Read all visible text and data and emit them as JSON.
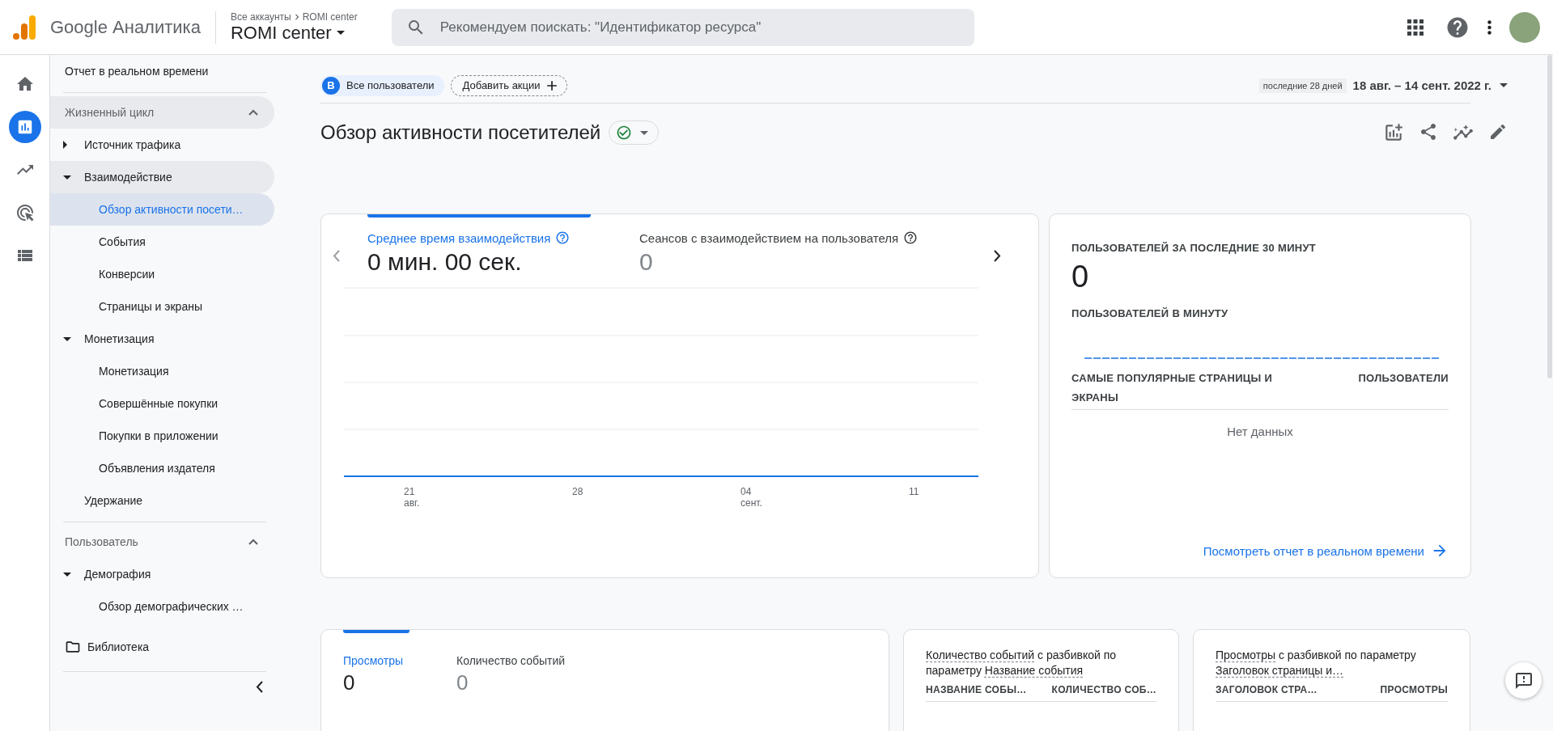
{
  "header": {
    "product": "Google Аналитика",
    "breadcrumb": [
      "Все аккаунты",
      "ROMI center"
    ],
    "property": "ROMI center",
    "search": {
      "placeholder": "Рекомендуем поискать: \"Идентификатор ресурса\""
    }
  },
  "rail": [
    {
      "kind": "home",
      "selected": false
    },
    {
      "kind": "reports",
      "selected": true
    },
    {
      "kind": "explore",
      "selected": false
    },
    {
      "kind": "advertising",
      "selected": false
    },
    {
      "kind": "configure",
      "selected": false
    }
  ],
  "sidebar": {
    "top_item": "Отчет в реальном времени",
    "sections": [
      {
        "title": "Жизненный цикл",
        "expanded": true,
        "highlighted": true,
        "items": [
          {
            "label": "Источник трафика",
            "kind": "group",
            "expanded": false,
            "highlighted": false,
            "selected": false
          },
          {
            "label": "Взаимодействие",
            "kind": "group",
            "expanded": true,
            "highlighted": true,
            "selected": false,
            "children": [
              {
                "label": "Обзор активности посети…",
                "selected": true
              },
              {
                "label": "События",
                "selected": false
              },
              {
                "label": "Конверсии",
                "selected": false
              },
              {
                "label": "Страницы и экраны",
                "selected": false
              }
            ]
          },
          {
            "label": "Монетизация",
            "kind": "group",
            "expanded": true,
            "highlighted": false,
            "selected": false,
            "children": [
              {
                "label": "Монетизация",
                "selected": false
              },
              {
                "label": "Совершённые покупки",
                "selected": false
              },
              {
                "label": "Покупки в приложении",
                "selected": false
              },
              {
                "label": "Объявления издателя",
                "selected": false
              }
            ]
          },
          {
            "label": "Удержание",
            "kind": "link",
            "highlighted": false,
            "selected": false
          }
        ]
      },
      {
        "title": "Пользователь",
        "expanded": true,
        "highlighted": false,
        "items": [
          {
            "label": "Демография",
            "kind": "group",
            "expanded": true,
            "highlighted": false,
            "selected": false,
            "children": [
              {
                "label": "Обзор демографических …",
                "selected": false
              }
            ]
          }
        ]
      }
    ],
    "library": "Библиотека"
  },
  "toolbar": {
    "segment": {
      "letter": "В",
      "label": "Все пользователи"
    },
    "compare": "Добавить акции",
    "date_badge": "последние 28 дней",
    "date_range": "18 авг. – 14 сент. 2022 г."
  },
  "report": {
    "title": "Обзор активности посетителей"
  },
  "engagement_card": {
    "metrics": [
      {
        "label": "Среднее время взаимодействия",
        "value": "0 мин. 00 сек.",
        "selected": true
      },
      {
        "label": "Сеансов с взаимодействием на пользователя",
        "value": "0",
        "selected": false
      }
    ],
    "axis_labels": [
      {
        "day": "21",
        "month": "авг."
      },
      {
        "day": "28"
      },
      {
        "day": "04",
        "month": "сент."
      },
      {
        "day": "11"
      }
    ]
  },
  "realtime_card": {
    "title": "ПОЛЬЗОВАТЕЛЕЙ ЗА ПОСЛЕДНИЕ 30 МИНУТ",
    "value": "0",
    "subtitle": "ПОЛЬЗОВАТЕЛЕЙ В МИНУТУ",
    "columns": [
      "САМЫЕ ПОПУЛЯРНЫЕ СТРАНИЦЫ И ЭКРАНЫ",
      "ПОЛЬЗОВАТЕЛИ"
    ],
    "empty": "Нет данных",
    "link": "Посмотреть отчет в реальном времени"
  },
  "views_card": {
    "metrics": [
      {
        "label": "Просмотры",
        "value": "0",
        "selected": true
      },
      {
        "label": "Количество событий",
        "value": "0",
        "selected": false
      }
    ]
  },
  "breakdown_cards": [
    {
      "title": [
        {
          "text": "Количество событий",
          "underlined": true
        },
        {
          "text": " с разбивкой по параметру ",
          "underlined": false
        },
        {
          "text": "Название события",
          "underlined": true
        }
      ],
      "columns": [
        "НАЗВАНИЕ СОБЫ…",
        "КОЛИЧЕСТВО СОБ…"
      ]
    },
    {
      "title": [
        {
          "text": "Просмотры",
          "underlined": true
        },
        {
          "text": " с разбивкой по параметру ",
          "underlined": false
        },
        {
          "text": "Заголовок страницы и…",
          "underlined": true
        }
      ],
      "columns": [
        "ЗАГОЛОВОК СТРА…",
        "ПРОСМОТРЫ"
      ]
    }
  ]
}
